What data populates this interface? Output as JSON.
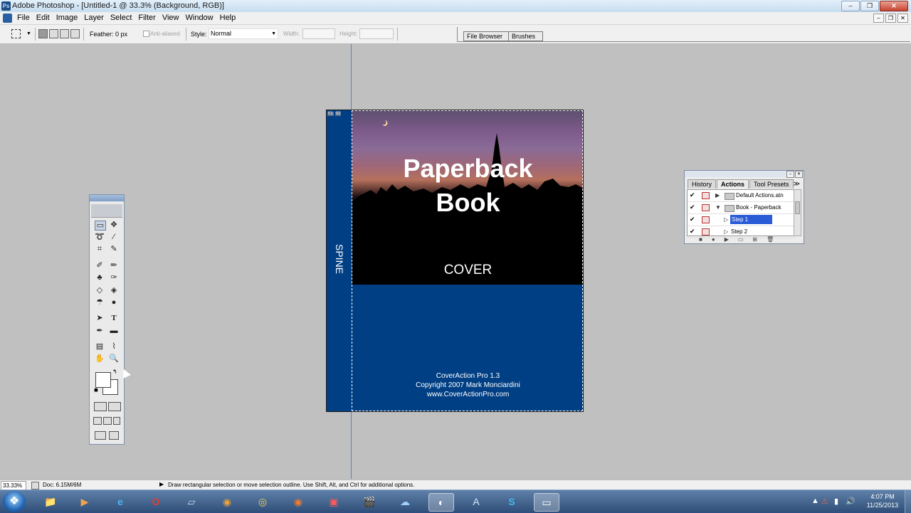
{
  "titlebar": {
    "title": "Adobe Photoshop - [Untitled-1 @ 33.3% (Background, RGB)]",
    "min": "–",
    "max": "❐",
    "close": "✕"
  },
  "menu": [
    "File",
    "Edit",
    "Image",
    "Layer",
    "Select",
    "Filter",
    "View",
    "Window",
    "Help"
  ],
  "options": {
    "feather_label": "Feather:",
    "feather_value": "0 px",
    "antialias_label": "Anti-aliased",
    "style_label": "Style:",
    "style_value": "Normal",
    "width_label": "Width:",
    "height_label": "Height:"
  },
  "palette_well": {
    "tab1": "File Browser",
    "tab2": "Brushes"
  },
  "document": {
    "spine_text": "SPINE",
    "badge1": "01",
    "badge2": "02",
    "title_line1": "Paperback",
    "title_line2": "Book",
    "cover_label": "COVER",
    "credit1": "CoverAction Pro 1.3",
    "credit2": "Copyright 2007 Mark Monciardini",
    "credit3": "www.CoverActionPro.com"
  },
  "actions_panel": {
    "tabs": [
      "History",
      "Actions",
      "Tool Presets"
    ],
    "menu_icon": "≫",
    "rows": [
      {
        "check": "✔",
        "label": "Default Actions.atn"
      },
      {
        "check": "✔",
        "label": "Book - Paperback"
      },
      {
        "check": "✔",
        "label": "Step 1"
      },
      {
        "check": "✔",
        "label": "Step 2"
      }
    ]
  },
  "status": {
    "zoom": "33.33%",
    "doc": "Doc: 6.15M/6M",
    "hint": "Draw rectangular selection or move selection outline.  Use Shift, Alt, and Ctrl for additional options."
  },
  "clock": {
    "time": "4:07 PM",
    "date": "11/25/2013"
  },
  "colors": {
    "doc_blue": "#003f84",
    "selection_blue": "#2a5bd7",
    "guide": "#5b83c8"
  }
}
